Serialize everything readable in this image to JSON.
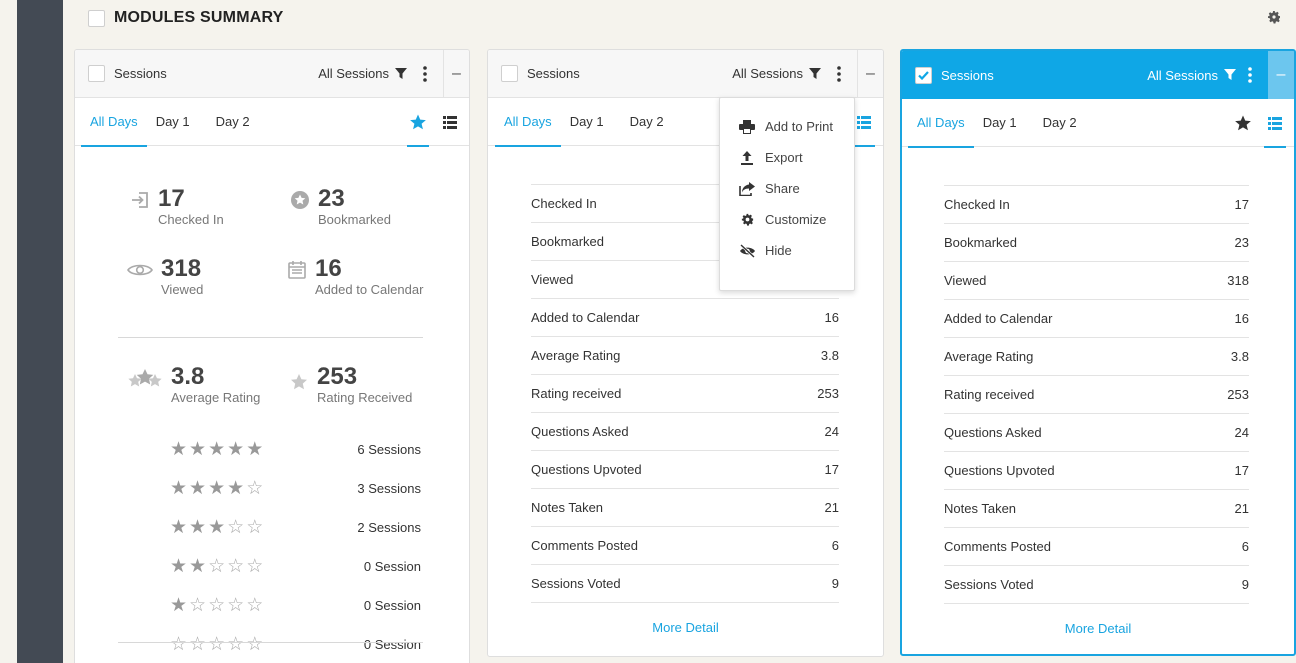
{
  "header": {
    "title": "MODULES SUMMARY"
  },
  "cards": [
    {
      "title": "Sessions",
      "filter": "All Sessions",
      "minus": "–",
      "tabs": [
        "All Days",
        "Day 1",
        "Day 2"
      ],
      "selected_tab": 0
    },
    {
      "title": "Sessions",
      "filter": "All Sessions",
      "minus": "–",
      "tabs": [
        "All Days",
        "Day 1",
        "Day 2"
      ],
      "selected_tab": 0
    },
    {
      "title": "Sessions",
      "filter": "All Sessions",
      "minus": "–",
      "tabs": [
        "All Days",
        "Day 1",
        "Day 2"
      ],
      "selected_tab": 0,
      "checked": true
    }
  ],
  "summary": {
    "checked_in": {
      "value": "17",
      "label": "Checked In"
    },
    "bookmarked": {
      "value": "23",
      "label": "Bookmarked"
    },
    "viewed": {
      "value": "318",
      "label": "Viewed"
    },
    "added_to_calendar": {
      "value": "16",
      "label": "Added to Calendar"
    },
    "average_rating": {
      "value": "3.8",
      "label": "Average Rating"
    },
    "rating_received": {
      "value": "253",
      "label": "Rating Received"
    },
    "rating_breakdown": [
      {
        "stars": 5,
        "label": "6 Sessions"
      },
      {
        "stars": 4,
        "label": "3 Sessions"
      },
      {
        "stars": 3,
        "label": "2 Sessions"
      },
      {
        "stars": 2,
        "label": "0 Session"
      },
      {
        "stars": 1,
        "label": "0 Session"
      },
      {
        "stars": 0,
        "label": "0 Session"
      }
    ]
  },
  "table_rows": [
    {
      "label": "Checked In",
      "value": "17"
    },
    {
      "label": "Bookmarked",
      "value": "23"
    },
    {
      "label": "Viewed",
      "value": "318"
    },
    {
      "label": "Added to Calendar",
      "value": "16"
    },
    {
      "label": "Average Rating",
      "value": "3.8"
    },
    {
      "label": "Rating received",
      "value": "253"
    },
    {
      "label": "Questions Asked",
      "value": "24"
    },
    {
      "label": "Questions Upvoted",
      "value": "17"
    },
    {
      "label": "Notes Taken",
      "value": "21"
    },
    {
      "label": "Comments Posted",
      "value": "6"
    },
    {
      "label": "Sessions Voted",
      "value": "9"
    }
  ],
  "more_detail": "More Detail",
  "menu": {
    "items": [
      {
        "label": "Add to Print",
        "icon": "print-icon"
      },
      {
        "label": "Export",
        "icon": "export-icon"
      },
      {
        "label": "Share",
        "icon": "share-icon"
      },
      {
        "label": "Customize",
        "icon": "gear-icon"
      },
      {
        "label": "Hide",
        "icon": "eye-slash-icon"
      }
    ]
  },
  "colors": {
    "accent": "#19a4e0",
    "sidebar": "#434a54",
    "background": "#f5f3ed"
  }
}
